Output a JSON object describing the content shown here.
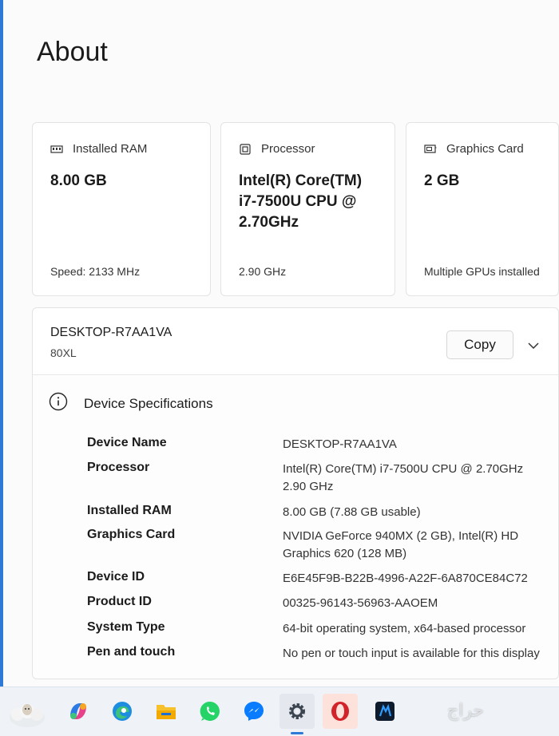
{
  "page": {
    "title": "About"
  },
  "cards": [
    {
      "icon": "memory-icon",
      "label": "Installed RAM",
      "value": "8.00 GB",
      "foot": "Speed: 2133 MHz"
    },
    {
      "icon": "processor-icon",
      "label": "Processor",
      "value": "Intel(R) Core(TM) i7-7500U CPU @ 2.70GHz",
      "foot": "2.90 GHz"
    },
    {
      "icon": "graphics-card-icon",
      "label": "Graphics Card",
      "value": "2 GB",
      "foot": "Multiple GPUs installed"
    }
  ],
  "device": {
    "name": "DESKTOP-R7AA1VA",
    "model": "80XL",
    "copy_label": "Copy"
  },
  "specs": {
    "title": "Device Specifications",
    "rows": [
      {
        "label": "Device Name",
        "value": "DESKTOP-R7AA1VA"
      },
      {
        "label": "Processor",
        "value": "Intel(R) Core(TM) i7-7500U CPU @ 2.70GHz 2.90 GHz"
      },
      {
        "label": "Installed RAM",
        "value": "8.00 GB (7.88 GB usable)"
      },
      {
        "label": "Graphics Card",
        "value": "NVIDIA GeForce 940MX (2 GB), Intel(R) HD Graphics 620 (128 MB)"
      },
      {
        "label": "Device ID",
        "value": "E6E45F9B-B22B-4996-A22F-6A870CE84C72"
      },
      {
        "label": "Product ID",
        "value": "00325-96143-56963-AAOEM"
      },
      {
        "label": "System Type",
        "value": "64-bit operating system, x64-based processor"
      },
      {
        "label": "Pen and touch",
        "value": "No pen or touch input is available for this display"
      }
    ]
  },
  "taskbar": {
    "items": [
      {
        "name": "weather-sheep-icon"
      },
      {
        "name": "copilot-icon"
      },
      {
        "name": "edge-icon"
      },
      {
        "name": "file-explorer-icon"
      },
      {
        "name": "whatsapp-icon"
      },
      {
        "name": "messenger-icon"
      },
      {
        "name": "settings-icon"
      },
      {
        "name": "opera-icon"
      },
      {
        "name": "app-icon"
      }
    ]
  },
  "watermark": "حراج",
  "colors": {
    "accent": "#2f7ad6",
    "card_border": "#e3e3e3",
    "background": "#fbfbfb",
    "opera_red": "#d2232a",
    "whatsapp_green": "#25d366"
  }
}
